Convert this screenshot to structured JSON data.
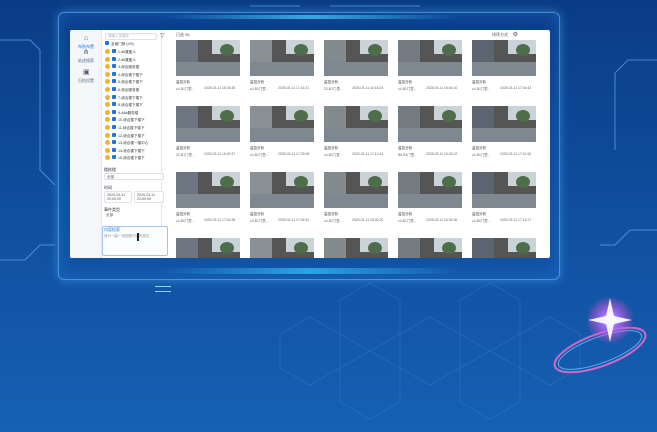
{
  "sidebar": {
    "items": [
      {
        "label": "布防布置",
        "icon": "home-icon",
        "active": true
      },
      {
        "label": "轨迹搜索",
        "icon": "share-icon",
        "active": false
      },
      {
        "label": "归档设置",
        "icon": "image-icon",
        "active": false
      }
    ]
  },
  "tree": {
    "search_placeholder": "请输入关键字",
    "root_label": "全部门禁 (0/0)",
    "nodes": [
      "1-6#集团人",
      "2-6#集团人",
      "3-综合服务楼",
      "4-综合楼下楼下",
      "5-综合楼下楼下",
      "6-综合服务楼",
      "7-综合楼下楼下",
      "8-综合楼下楼下",
      "9-A6#服务楼",
      "10-综合楼下楼下",
      "11-综合楼下楼下",
      "12-综合楼下楼下",
      "13-综合楼一楼中心",
      "14-综合楼下楼下",
      "15-综合楼下楼下"
    ]
  },
  "filters": {
    "area_label": "楼栋楼",
    "area_value": "全部",
    "time_label": "时间",
    "time_start": "2025-03-11 00:00:00",
    "time_end": "2025-03-11 23:59:59",
    "event_label": "事件类型",
    "event_value": "全部",
    "content_label": "内容检索",
    "content_placeholder": "请对一幅/一组图像内容的描述..."
  },
  "main": {
    "header_left": "已选 96",
    "header_right": "排序方式"
  },
  "cards": [
    {
      "title": "监控分析",
      "meta_left": "c4-B1门里...",
      "meta_right": "2025-03-11 16:34:35"
    },
    {
      "title": "监控分析",
      "meta_left": "c4-B1门里...",
      "meta_right": "2025-03-11 17:14:21"
    },
    {
      "title": "监控分析",
      "meta_left": "22-B1门里...",
      "meta_right": "2025-03-11 16:18:24"
    },
    {
      "title": "监控分析",
      "meta_left": "c4-B1门里...",
      "meta_right": "2025-03-11 16:44:10"
    },
    {
      "title": "监控分析",
      "meta_left": "c4-B1门里...",
      "meta_right": "2025-03-11 17:04:43"
    },
    {
      "title": "监控分析",
      "meta_left": "22-B1门里...",
      "meta_right": "2025-03-11 16:00:37"
    },
    {
      "title": "监控分析",
      "meta_left": "c4-B1门里...",
      "meta_right": "2025-03-11 17:25:08"
    },
    {
      "title": "监控分析",
      "meta_left": "c4-B1门里...",
      "meta_right": "2025-03-11 17:12:41"
    },
    {
      "title": "监控分析",
      "meta_left": "B6-B1门里...",
      "meta_right": "2025-03-11 16:04:02"
    },
    {
      "title": "监控分析",
      "meta_left": "c4-B1门里...",
      "meta_right": "2025-03-11 17:01:52"
    },
    {
      "title": "监控分析",
      "meta_left": "c4-B1门里...",
      "meta_right": "2025-03-11 17:44:35"
    },
    {
      "title": "监控分析",
      "meta_left": "c4-B1门里...",
      "meta_right": "2025-03-11 17:04:51"
    },
    {
      "title": "监控分析",
      "meta_left": "c4-B1门里...",
      "meta_right": "2025-03-11 16:30:20"
    },
    {
      "title": "监控分析",
      "meta_left": "c4-B1门里...",
      "meta_right": "2025-03-11 16:34:36"
    },
    {
      "title": "监控分析",
      "meta_left": "c4-B1门里...",
      "meta_right": "2025-03-11 17:14:27"
    },
    {
      "title": "",
      "meta_left": "",
      "meta_right": ""
    },
    {
      "title": "",
      "meta_left": "",
      "meta_right": ""
    },
    {
      "title": "",
      "meta_left": "",
      "meta_right": ""
    },
    {
      "title": "",
      "meta_left": "",
      "meta_right": ""
    },
    {
      "title": "",
      "meta_left": "",
      "meta_right": ""
    }
  ],
  "colors": {
    "accent": "#1a74e8",
    "background": "#0f4d9c",
    "folder": "#f2b035"
  }
}
